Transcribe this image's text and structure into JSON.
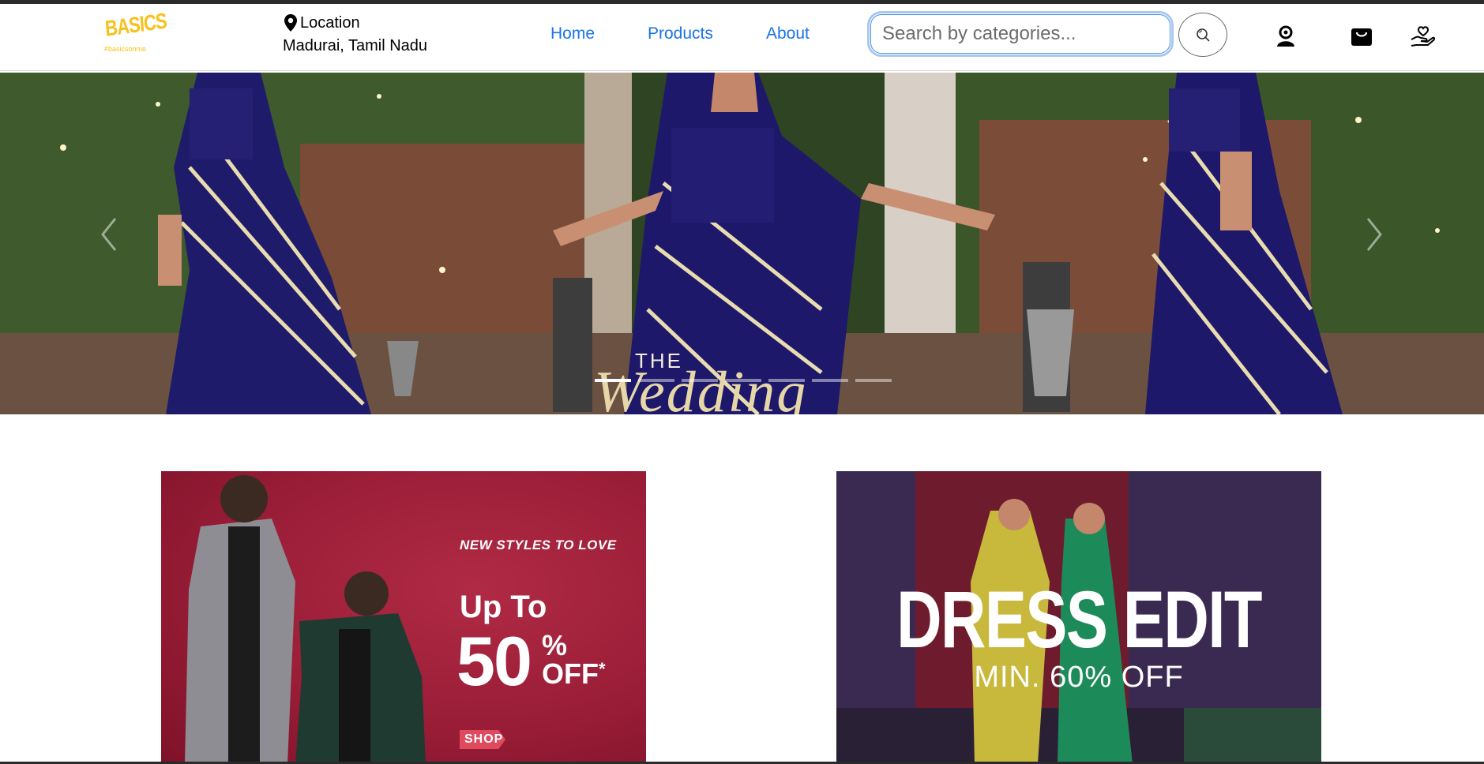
{
  "brand": {
    "logo_text": "BASICS",
    "logo_tagline": "#basicsonme",
    "logo_color": "#f7c21c"
  },
  "location": {
    "label": "Location",
    "value": "Madurai, Tamil Nadu",
    "icon": "map-pin-icon"
  },
  "nav": {
    "links": [
      {
        "label": "Home"
      },
      {
        "label": "Products"
      },
      {
        "label": "About"
      }
    ],
    "link_color": "#1a73e8"
  },
  "search": {
    "value": "",
    "placeholder": "Search by categories...",
    "button_icon": "search-icon"
  },
  "header_icons": [
    "user-icon",
    "cart-icon",
    "hand-heart-icon"
  ],
  "hero": {
    "caption_small": "THE",
    "caption_large": "Wedding",
    "slide_count": 7,
    "active_slide": 1
  },
  "promos": {
    "left": {
      "tagline": "NEW STYLES TO LOVE",
      "upto": "Up To",
      "amount": "50",
      "percent": "%",
      "off": "OFF",
      "asterisk": "*",
      "shop_label": "SHOP"
    },
    "right": {
      "title": "DRESS EDIT",
      "subtitle": "MIN. 60% OFF"
    }
  }
}
